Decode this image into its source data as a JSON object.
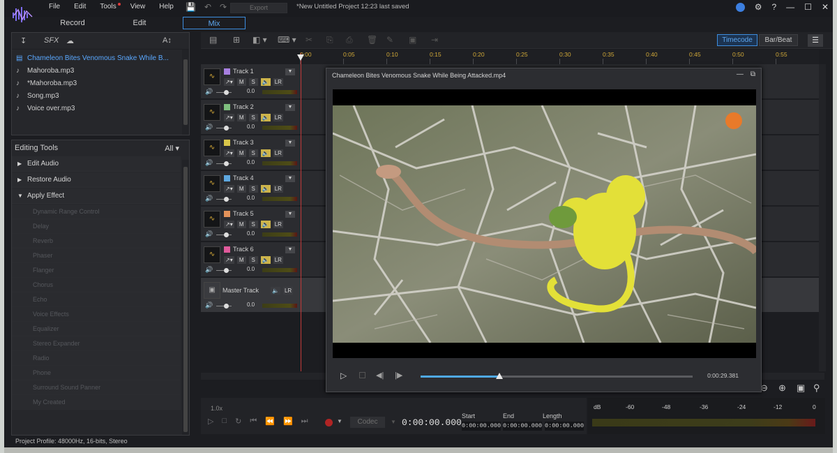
{
  "menu": {
    "items": [
      "File",
      "Edit",
      "Tools",
      "View",
      "Help"
    ],
    "export_label": "Export",
    "project_title": "*New Untitled Project",
    "saved_status": "12:23 last saved"
  },
  "window_controls": {
    "help": "?"
  },
  "mode_tabs": [
    "Record",
    "Edit",
    "Mix"
  ],
  "library": {
    "toolbar": {
      "sfx": "SFX",
      "text_size": "A↕"
    },
    "items": [
      {
        "label": "Chameleon Bites Venomous Snake While B...",
        "icon": "video-file-icon",
        "selected": true
      },
      {
        "label": "Mahoroba.mp3",
        "icon": "music-note-icon",
        "selected": false
      },
      {
        "label": "*Mahoroba.mp3",
        "icon": "music-note-icon",
        "selected": false
      },
      {
        "label": "Song.mp3",
        "icon": "music-note-icon",
        "selected": false
      },
      {
        "label": "Voice over.mp3",
        "icon": "music-note-icon",
        "selected": false
      }
    ]
  },
  "editing_tools": {
    "title": "Editing Tools",
    "filter": "All",
    "groups": [
      {
        "label": "Edit Audio",
        "expanded": false
      },
      {
        "label": "Restore Audio",
        "expanded": false
      },
      {
        "label": "Apply Effect",
        "expanded": true
      }
    ],
    "effects": [
      "Dynamic Range Control",
      "Delay",
      "Reverb",
      "Phaser",
      "Flanger",
      "Chorus",
      "Echo",
      "Voice Effects",
      "Equalizer",
      "Stereo Expander",
      "Radio",
      "Phone",
      "Surround Sound Panner",
      "My Created"
    ]
  },
  "toolbar": {
    "timecode": "Timecode",
    "barbeat": "Bar/Beat"
  },
  "ruler": {
    "ticks": [
      "0:00",
      "0:05",
      "0:10",
      "0:15",
      "0:20",
      "0:25",
      "0:30",
      "0:35",
      "0:40",
      "0:45",
      "0:50",
      "0:55"
    ]
  },
  "tracks": [
    {
      "name": "Track 1",
      "color": "#a77fe0",
      "volume": "0.0"
    },
    {
      "name": "Track 2",
      "color": "#7fbf7f",
      "volume": "0.0"
    },
    {
      "name": "Track 3",
      "color": "#d9c64a",
      "volume": "0.0"
    },
    {
      "name": "Track 4",
      "color": "#5ea8e0",
      "volume": "0.0"
    },
    {
      "name": "Track 5",
      "color": "#e3925a",
      "volume": "0.0"
    },
    {
      "name": "Track 6",
      "color": "#e05a9b",
      "volume": "0.0"
    }
  ],
  "track_buttons": {
    "mute": "M",
    "solo": "S",
    "pan": "LR"
  },
  "master_track": {
    "name": "Master Track",
    "volume": "0.0"
  },
  "transport": {
    "rate": "1.0x",
    "codec": "Codec",
    "time": "0:00:00.000",
    "start_label": "Start",
    "end_label": "End",
    "length_label": "Length",
    "start": "0:00:00.000",
    "end": "0:00:00.000",
    "length": "0:00:00.000"
  },
  "levels": {
    "labels": [
      "dB",
      "-60",
      "-48",
      "-36",
      "-24",
      "-12",
      "0"
    ]
  },
  "player": {
    "title": "Chameleon Bites Venomous Snake While Being Attacked.mp4",
    "time": "0:00:29.381",
    "progress": 0.29
  },
  "status": {
    "profile": "Project Profile: 48000Hz, 16-bits, Stereo"
  }
}
